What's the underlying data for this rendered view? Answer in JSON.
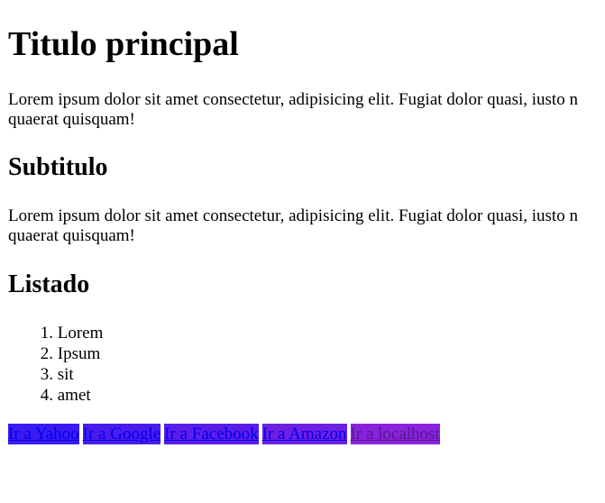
{
  "title": "Titulo principal",
  "paragraph1": {
    "line1": "Lorem ipsum dolor sit amet consectetur, adipisicing elit. Fugiat dolor quasi, iusto n",
    "line2": "quaerat quisquam!"
  },
  "subtitle": "Subtitulo",
  "paragraph2": {
    "line1": "Lorem ipsum dolor sit amet consectetur, adipisicing elit. Fugiat dolor quasi, iusto n",
    "line2": "quaerat quisquam!"
  },
  "list_heading": "Listado",
  "list": [
    {
      "num": "1.",
      "text": "Lorem"
    },
    {
      "num": "2.",
      "text": "Ipsum"
    },
    {
      "num": "3.",
      "text": "sit"
    },
    {
      "num": "4.",
      "text": "amet"
    }
  ],
  "links": [
    {
      "label": "Ir a Yahoo",
      "bg": "#3a1cf0",
      "visited": false
    },
    {
      "label": "Ir a Google",
      "bg": "#4a1cec",
      "visited": false
    },
    {
      "label": "Ir a Facebook",
      "bg": "#5b1ee8",
      "visited": false
    },
    {
      "label": "Ir a Amazon",
      "bg": "#6e20e2",
      "visited": false
    },
    {
      "label": "Ir a localhost",
      "bg": "#8a22dc",
      "visited": true
    }
  ]
}
